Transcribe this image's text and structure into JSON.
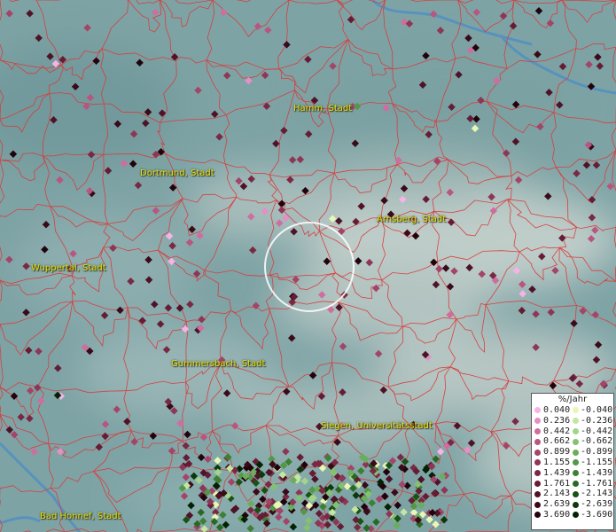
{
  "map": {
    "colors": {
      "border_lines": "#d93b3b",
      "river": "#4e8fc4",
      "label": "#e7e600",
      "terrain_light": "#c9d3cf",
      "terrain_dark": "#6b8f92"
    },
    "city_labels": [
      {
        "name": "Hamm, Stadt"
      },
      {
        "name": "Dortmund, Stadt"
      },
      {
        "name": "Arnsberg, Stadt"
      },
      {
        "name": "Wuppertal, Stadt"
      },
      {
        "name": "Gummersbach, Stadt"
      },
      {
        "name": "Siegen, Universitätsstadt"
      },
      {
        "name": "Bad Honnef, Stadt"
      }
    ],
    "highlight": "selection-circle"
  },
  "legend": {
    "title": "%/Jahr",
    "positive": [
      {
        "value": "0.040",
        "color": "#f5b3e6"
      },
      {
        "value": "0.236",
        "color": "#e58fc6"
      },
      {
        "value": "0.442",
        "color": "#cf6d9f"
      },
      {
        "value": "0.662",
        "color": "#b85680"
      },
      {
        "value": "0.899",
        "color": "#a34569"
      },
      {
        "value": "1.155",
        "color": "#8e3656"
      },
      {
        "value": "1.439",
        "color": "#7a2944"
      },
      {
        "value": "1.761",
        "color": "#651d35"
      },
      {
        "value": "2.143",
        "color": "#4f1327"
      },
      {
        "value": "2.639",
        "color": "#3a0a1a"
      },
      {
        "value": "3.690",
        "color": "#22030d"
      }
    ],
    "negative": [
      {
        "value": "-0.040",
        "color": "#e9f7b5"
      },
      {
        "value": "-0.236",
        "color": "#c4e69f"
      },
      {
        "value": "-0.442",
        "color": "#a2d587"
      },
      {
        "value": "-0.662",
        "color": "#83c26f"
      },
      {
        "value": "-0.899",
        "color": "#69ae5a"
      },
      {
        "value": "-1.155",
        "color": "#529846"
      },
      {
        "value": "-1.439",
        "color": "#3d8034"
      },
      {
        "value": "-1.761",
        "color": "#2a6924"
      },
      {
        "value": "-2.143",
        "color": "#1a5116"
      },
      {
        "value": "-2.639",
        "color": "#0c390b"
      },
      {
        "value": "-3.690",
        "color": "#032203"
      }
    ]
  }
}
